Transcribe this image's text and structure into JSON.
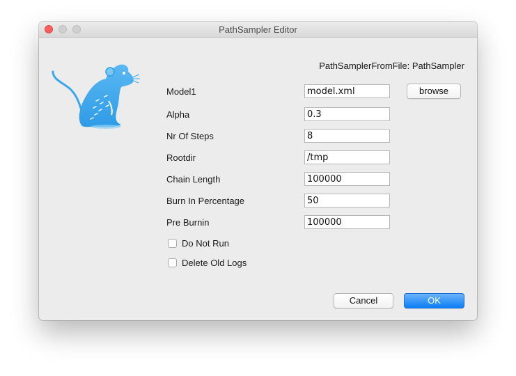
{
  "window": {
    "title": "PathSampler Editor"
  },
  "header": {
    "class_label": "PathSamplerFromFile: PathSampler"
  },
  "fields": [
    {
      "label": "Model1",
      "value": "model.xml"
    },
    {
      "label": "Alpha",
      "value": "0.3"
    },
    {
      "label": "Nr Of Steps",
      "value": "8"
    },
    {
      "label": "Rootdir",
      "value": "/tmp"
    },
    {
      "label": "Chain Length",
      "value": "100000"
    },
    {
      "label": "Burn In Percentage",
      "value": "50"
    },
    {
      "label": "Pre Burnin",
      "value": "100000"
    }
  ],
  "browse_label": "browse",
  "checks": [
    {
      "label": "Do Not Run",
      "checked": false
    },
    {
      "label": "Delete Old Logs",
      "checked": false
    }
  ],
  "buttons": {
    "cancel": "Cancel",
    "ok": "OK"
  },
  "colors": {
    "accent": "#0b7ef6",
    "close": "#fc605c",
    "logo": "#3aa6ee"
  },
  "icons": {
    "logo": "mouse-logo-icon"
  }
}
